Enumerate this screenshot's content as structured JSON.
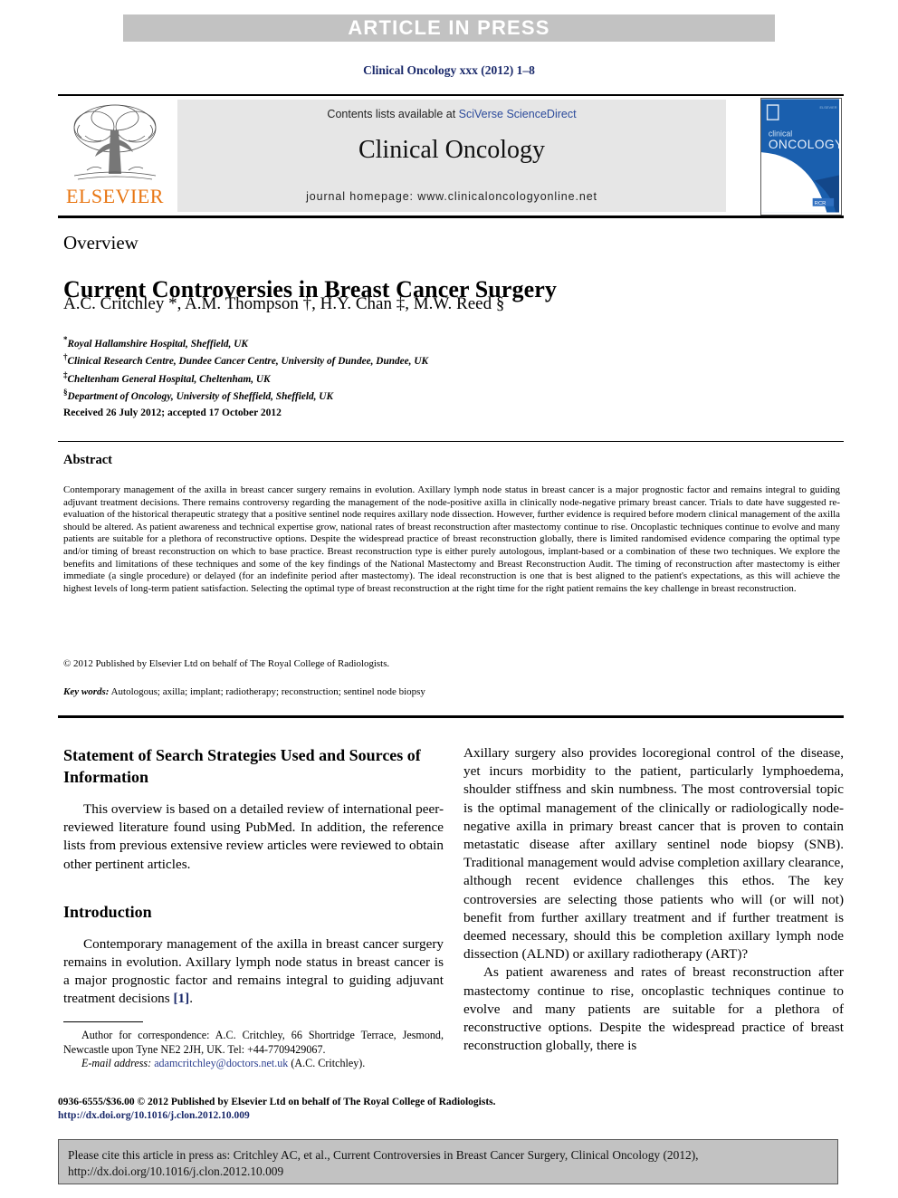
{
  "banner": {
    "text": "ARTICLE IN PRESS"
  },
  "journal_ref": "Clinical Oncology xxx (2012) 1–8",
  "masthead": {
    "publisher_name": "ELSEVIER",
    "contents_prefix": "Contents lists available at ",
    "contents_link": "SciVerse ScienceDirect",
    "journal_title": "Clinical Oncology",
    "homepage": "journal homepage: www.clinicaloncologyonline.net",
    "cover": {
      "line1": "clinical",
      "line2": "ONCOLOGY",
      "badge": "RCR"
    }
  },
  "article": {
    "type_label": "Overview",
    "title": "Current Controversies in Breast Cancer Surgery",
    "authors_plain": "A.C. Critchley *, A.M. Thompson †, H.Y. Chan ‡, M.W. Reed §",
    "affiliations": [
      {
        "mark": "*",
        "text": "Royal Hallamshire Hospital, Sheffield, UK"
      },
      {
        "mark": "†",
        "text": "Clinical Research Centre, Dundee Cancer Centre, University of Dundee, Dundee, UK"
      },
      {
        "mark": "‡",
        "text": "Cheltenham General Hospital, Cheltenham, UK"
      },
      {
        "mark": "§",
        "text": "Department of Oncology, University of Sheffield, Sheffield, UK"
      }
    ],
    "history": "Received 26 July 2012; accepted 17 October 2012"
  },
  "abstract": {
    "heading": "Abstract",
    "body": "Contemporary management of the axilla in breast cancer surgery remains in evolution. Axillary lymph node status in breast cancer is a major prognostic factor and remains integral to guiding adjuvant treatment decisions. There remains controversy regarding the management of the node-positive axilla in clinically node-negative primary breast cancer. Trials to date have suggested re-evaluation of the historical therapeutic strategy that a positive sentinel node requires axillary node dissection. However, further evidence is required before modern clinical management of the axilla should be altered. As patient awareness and technical expertise grow, national rates of breast reconstruction after mastectomy continue to rise. Oncoplastic techniques continue to evolve and many patients are suitable for a plethora of reconstructive options. Despite the widespread practice of breast reconstruction globally, there is limited randomised evidence comparing the optimal type and/or timing of breast reconstruction on which to base practice. Breast reconstruction type is either purely autologous, implant-based or a combination of these two techniques. We explore the benefits and limitations of these techniques and some of the key findings of the National Mastectomy and Breast Reconstruction Audit. The timing of reconstruction after mastectomy is either immediate (a single procedure) or delayed (for an indefinite period after mastectomy). The ideal reconstruction is one that is best aligned to the patient's expectations, as this will achieve the highest levels of long-term patient satisfaction. Selecting the optimal type of breast reconstruction at the right time for the right patient remains the key challenge in breast reconstruction.",
    "copyright": "© 2012 Published by Elsevier Ltd on behalf of The Royal College of Radiologists.",
    "keywords_label": "Key words:",
    "keywords_value": "Autologous; axilla; implant; radiotherapy; reconstruction; sentinel node biopsy"
  },
  "left_column": {
    "search_heading": "Statement of Search Strategies Used and Sources of Information",
    "search_par": "This overview is based on a detailed review of international peer-reviewed literature found using PubMed. In addition, the reference lists from previous extensive review articles were reviewed to obtain other pertinent articles.",
    "intro_heading": "Introduction",
    "intro_par_pre": "Contemporary management of the axilla in breast cancer surgery remains in evolution. Axillary lymph node status in breast cancer is a major prognostic factor and remains integral to guiding adjuvant treatment decisions ",
    "intro_ref": "[1]",
    "intro_par_post": "."
  },
  "right_column": {
    "par1": "Axillary surgery also provides locoregional control of the disease, yet incurs morbidity to the patient, particularly lymphoedema, shoulder stiffness and skin numbness. The most controversial topic is the optimal management of the clinically or radiologically node-negative axilla in primary breast cancer that is proven to contain metastatic disease after axillary sentinel node biopsy (SNB). Traditional management would advise completion axillary clearance, although recent evidence challenges this ethos. The key controversies are selecting those patients who will (or will not) benefit from further axillary treatment and if further treatment is deemed necessary, should this be completion axillary lymph node dissection (ALND) or axillary radiotherapy (ART)?",
    "par2": "As patient awareness and rates of breast reconstruction after mastectomy continue to rise, oncoplastic techniques continue to evolve and many patients are suitable for a plethora of reconstructive options. Despite the widespread practice of breast reconstruction globally, there is"
  },
  "footnote": {
    "correspondence_label": "Author for correspondence:",
    "correspondence_text": " A.C. Critchley, 66 Shortridge Terrace, Jesmond, Newcastle upon Tyne NE2 2JH, UK. Tel: +44-7709429067.",
    "email_label": "E-mail address:",
    "email_value": "adamcritchley@doctors.net.uk",
    "email_suffix": " (A.C. Critchley)."
  },
  "footer": {
    "issn_line": "0936-6555/$36.00 © 2012 Published by Elsevier Ltd on behalf of The Royal College of Radiologists.",
    "doi_line": "http://dx.doi.org/10.1016/j.clon.2012.10.009",
    "cite_text": "Please cite this article in press as: Critchley AC, et al., Current Controversies in Breast Cancer Surgery, Clinical Oncology (2012), http://dx.doi.org/10.1016/j.clon.2012.10.009"
  },
  "colors": {
    "banner_grey": "#c2c2c2",
    "panel_grey": "#e6e6e6",
    "link_blue": "#2b4a9b",
    "journal_blue": "#1b2a6b",
    "elsevier_orange": "#e87511",
    "cover_blue": "#1a5fae"
  }
}
